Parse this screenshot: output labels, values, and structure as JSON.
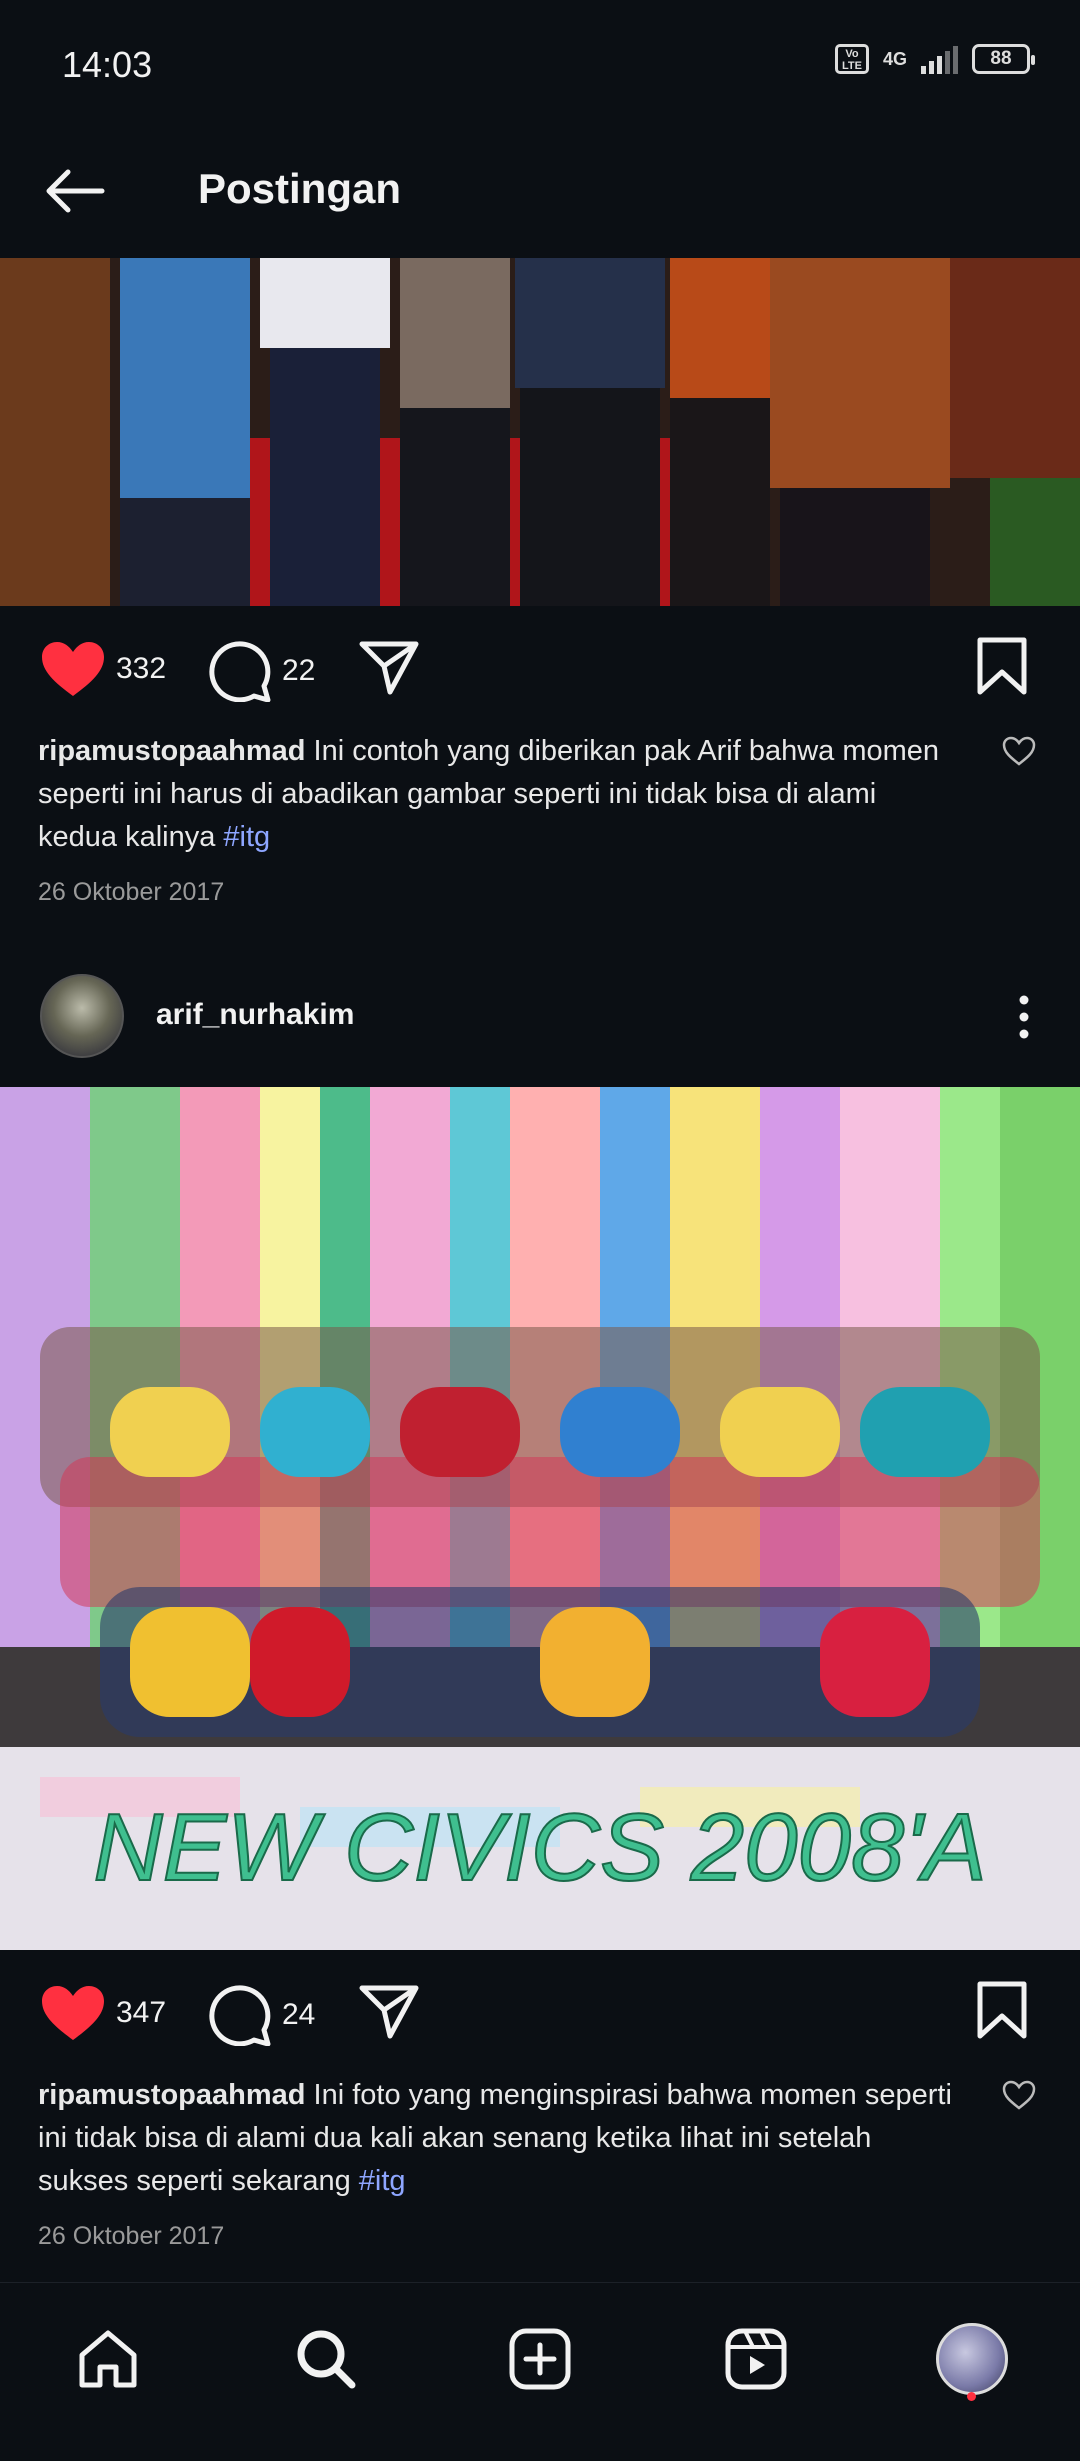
{
  "status_bar": {
    "time": "14:03",
    "network": "4G",
    "volte": "Vo LTE",
    "battery": "88"
  },
  "header": {
    "title": "Postingan"
  },
  "posts": [
    {
      "likes": "332",
      "comments": "22",
      "caption_user": "ripamustopaahmad",
      "caption_text": " Ini contoh yang diberikan pak Arif bahwa momen seperti ini harus di abadikan gambar seperti ini tidak bisa di alami kedua kalinya ",
      "hashtag": "#itg",
      "date": "26 Oktober 2017"
    },
    {
      "author": "arif_nurhakim",
      "image_text": "NEW CIVICS 2008'A",
      "likes": "347",
      "comments": "24",
      "caption_user": "ripamustopaahmad",
      "caption_text": " Ini foto yang menginspirasi bahwa momen seperti ini tidak bisa di alami dua kali akan senang ketika lihat ini setelah sukses seperti sekarang ",
      "hashtag": "#itg",
      "date": "26 Oktober 2017"
    }
  ],
  "nav": [
    "home-icon",
    "search-icon",
    "create-icon",
    "reels-icon",
    "profile-avatar"
  ],
  "colors": {
    "background": "#0b0f14",
    "like": "#ff3040",
    "hashtag": "#8ea6ff",
    "muted": "#9a9a9a"
  }
}
